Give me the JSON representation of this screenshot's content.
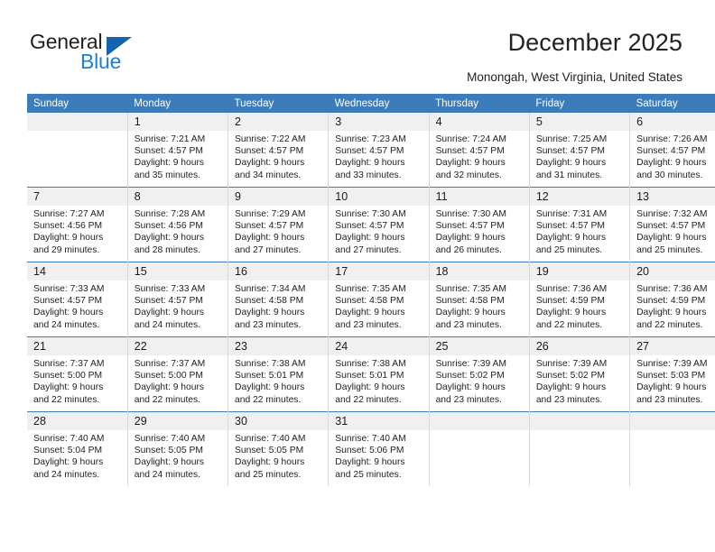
{
  "brand": {
    "name_top": "General",
    "name_bottom": "Blue",
    "triangle_color": "#1464ad",
    "blue_color": "#1c7fd4"
  },
  "header": {
    "title": "December 2025",
    "subtitle": "Monongah, West Virginia, United States"
  },
  "theme": {
    "header_blue": "#3d7cba",
    "daynum_band": "#f0f0f0",
    "cell_border": "#d8d8d8"
  },
  "calendar": {
    "weekday_headers": [
      "Sunday",
      "Monday",
      "Tuesday",
      "Wednesday",
      "Thursday",
      "Friday",
      "Saturday"
    ],
    "weeks": [
      [
        {
          "day": "",
          "blank": true,
          "sunrise": "",
          "sunset": "",
          "daylight1": "",
          "daylight2": ""
        },
        {
          "day": "1",
          "sunrise": "Sunrise: 7:21 AM",
          "sunset": "Sunset: 4:57 PM",
          "daylight1": "Daylight: 9 hours",
          "daylight2": "and 35 minutes."
        },
        {
          "day": "2",
          "sunrise": "Sunrise: 7:22 AM",
          "sunset": "Sunset: 4:57 PM",
          "daylight1": "Daylight: 9 hours",
          "daylight2": "and 34 minutes."
        },
        {
          "day": "3",
          "sunrise": "Sunrise: 7:23 AM",
          "sunset": "Sunset: 4:57 PM",
          "daylight1": "Daylight: 9 hours",
          "daylight2": "and 33 minutes."
        },
        {
          "day": "4",
          "sunrise": "Sunrise: 7:24 AM",
          "sunset": "Sunset: 4:57 PM",
          "daylight1": "Daylight: 9 hours",
          "daylight2": "and 32 minutes."
        },
        {
          "day": "5",
          "sunrise": "Sunrise: 7:25 AM",
          "sunset": "Sunset: 4:57 PM",
          "daylight1": "Daylight: 9 hours",
          "daylight2": "and 31 minutes."
        },
        {
          "day": "6",
          "sunrise": "Sunrise: 7:26 AM",
          "sunset": "Sunset: 4:57 PM",
          "daylight1": "Daylight: 9 hours",
          "daylight2": "and 30 minutes."
        }
      ],
      [
        {
          "day": "7",
          "sunrise": "Sunrise: 7:27 AM",
          "sunset": "Sunset: 4:56 PM",
          "daylight1": "Daylight: 9 hours",
          "daylight2": "and 29 minutes."
        },
        {
          "day": "8",
          "sunrise": "Sunrise: 7:28 AM",
          "sunset": "Sunset: 4:56 PM",
          "daylight1": "Daylight: 9 hours",
          "daylight2": "and 28 minutes."
        },
        {
          "day": "9",
          "sunrise": "Sunrise: 7:29 AM",
          "sunset": "Sunset: 4:57 PM",
          "daylight1": "Daylight: 9 hours",
          "daylight2": "and 27 minutes."
        },
        {
          "day": "10",
          "sunrise": "Sunrise: 7:30 AM",
          "sunset": "Sunset: 4:57 PM",
          "daylight1": "Daylight: 9 hours",
          "daylight2": "and 27 minutes."
        },
        {
          "day": "11",
          "sunrise": "Sunrise: 7:30 AM",
          "sunset": "Sunset: 4:57 PM",
          "daylight1": "Daylight: 9 hours",
          "daylight2": "and 26 minutes."
        },
        {
          "day": "12",
          "sunrise": "Sunrise: 7:31 AM",
          "sunset": "Sunset: 4:57 PM",
          "daylight1": "Daylight: 9 hours",
          "daylight2": "and 25 minutes."
        },
        {
          "day": "13",
          "sunrise": "Sunrise: 7:32 AM",
          "sunset": "Sunset: 4:57 PM",
          "daylight1": "Daylight: 9 hours",
          "daylight2": "and 25 minutes."
        }
      ],
      [
        {
          "day": "14",
          "sunrise": "Sunrise: 7:33 AM",
          "sunset": "Sunset: 4:57 PM",
          "daylight1": "Daylight: 9 hours",
          "daylight2": "and 24 minutes."
        },
        {
          "day": "15",
          "sunrise": "Sunrise: 7:33 AM",
          "sunset": "Sunset: 4:57 PM",
          "daylight1": "Daylight: 9 hours",
          "daylight2": "and 24 minutes."
        },
        {
          "day": "16",
          "sunrise": "Sunrise: 7:34 AM",
          "sunset": "Sunset: 4:58 PM",
          "daylight1": "Daylight: 9 hours",
          "daylight2": "and 23 minutes."
        },
        {
          "day": "17",
          "sunrise": "Sunrise: 7:35 AM",
          "sunset": "Sunset: 4:58 PM",
          "daylight1": "Daylight: 9 hours",
          "daylight2": "and 23 minutes."
        },
        {
          "day": "18",
          "sunrise": "Sunrise: 7:35 AM",
          "sunset": "Sunset: 4:58 PM",
          "daylight1": "Daylight: 9 hours",
          "daylight2": "and 23 minutes."
        },
        {
          "day": "19",
          "sunrise": "Sunrise: 7:36 AM",
          "sunset": "Sunset: 4:59 PM",
          "daylight1": "Daylight: 9 hours",
          "daylight2": "and 22 minutes."
        },
        {
          "day": "20",
          "sunrise": "Sunrise: 7:36 AM",
          "sunset": "Sunset: 4:59 PM",
          "daylight1": "Daylight: 9 hours",
          "daylight2": "and 22 minutes."
        }
      ],
      [
        {
          "day": "21",
          "sunrise": "Sunrise: 7:37 AM",
          "sunset": "Sunset: 5:00 PM",
          "daylight1": "Daylight: 9 hours",
          "daylight2": "and 22 minutes."
        },
        {
          "day": "22",
          "sunrise": "Sunrise: 7:37 AM",
          "sunset": "Sunset: 5:00 PM",
          "daylight1": "Daylight: 9 hours",
          "daylight2": "and 22 minutes."
        },
        {
          "day": "23",
          "sunrise": "Sunrise: 7:38 AM",
          "sunset": "Sunset: 5:01 PM",
          "daylight1": "Daylight: 9 hours",
          "daylight2": "and 22 minutes."
        },
        {
          "day": "24",
          "sunrise": "Sunrise: 7:38 AM",
          "sunset": "Sunset: 5:01 PM",
          "daylight1": "Daylight: 9 hours",
          "daylight2": "and 22 minutes."
        },
        {
          "day": "25",
          "sunrise": "Sunrise: 7:39 AM",
          "sunset": "Sunset: 5:02 PM",
          "daylight1": "Daylight: 9 hours",
          "daylight2": "and 23 minutes."
        },
        {
          "day": "26",
          "sunrise": "Sunrise: 7:39 AM",
          "sunset": "Sunset: 5:02 PM",
          "daylight1": "Daylight: 9 hours",
          "daylight2": "and 23 minutes."
        },
        {
          "day": "27",
          "sunrise": "Sunrise: 7:39 AM",
          "sunset": "Sunset: 5:03 PM",
          "daylight1": "Daylight: 9 hours",
          "daylight2": "and 23 minutes."
        }
      ],
      [
        {
          "day": "28",
          "sunrise": "Sunrise: 7:40 AM",
          "sunset": "Sunset: 5:04 PM",
          "daylight1": "Daylight: 9 hours",
          "daylight2": "and 24 minutes."
        },
        {
          "day": "29",
          "sunrise": "Sunrise: 7:40 AM",
          "sunset": "Sunset: 5:05 PM",
          "daylight1": "Daylight: 9 hours",
          "daylight2": "and 24 minutes."
        },
        {
          "day": "30",
          "sunrise": "Sunrise: 7:40 AM",
          "sunset": "Sunset: 5:05 PM",
          "daylight1": "Daylight: 9 hours",
          "daylight2": "and 25 minutes."
        },
        {
          "day": "31",
          "sunrise": "Sunrise: 7:40 AM",
          "sunset": "Sunset: 5:06 PM",
          "daylight1": "Daylight: 9 hours",
          "daylight2": "and 25 minutes."
        },
        {
          "day": "",
          "blank": true,
          "sunrise": "",
          "sunset": "",
          "daylight1": "",
          "daylight2": ""
        },
        {
          "day": "",
          "blank": true,
          "sunrise": "",
          "sunset": "",
          "daylight1": "",
          "daylight2": ""
        },
        {
          "day": "",
          "blank": true,
          "sunrise": "",
          "sunset": "",
          "daylight1": "",
          "daylight2": ""
        }
      ]
    ]
  }
}
